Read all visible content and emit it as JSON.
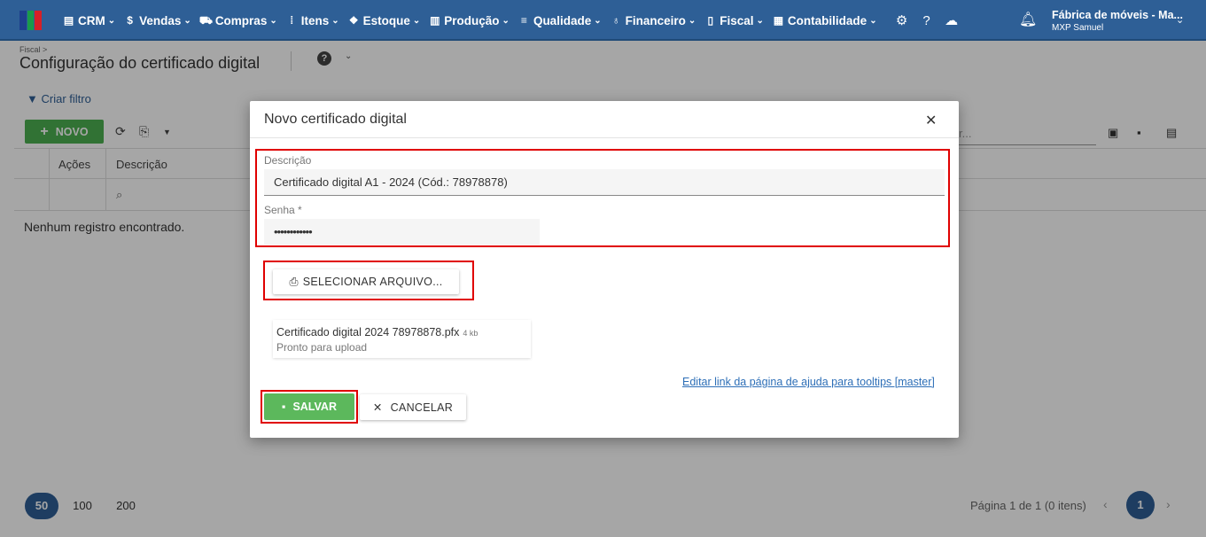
{
  "topbar": {
    "nav": [
      {
        "label": "CRM",
        "icon": "crm-icon"
      },
      {
        "label": "Vendas",
        "icon": "dollar-icon"
      },
      {
        "label": "Compras",
        "icon": "cart-icon"
      },
      {
        "label": "Itens",
        "icon": "items-icon"
      },
      {
        "label": "Estoque",
        "icon": "stock-icon"
      },
      {
        "label": "Produção",
        "icon": "factory-icon"
      },
      {
        "label": "Qualidade",
        "icon": "quality-icon"
      },
      {
        "label": "Financeiro",
        "icon": "money-bag-icon"
      },
      {
        "label": "Fiscal",
        "icon": "document-icon"
      },
      {
        "label": "Contabilidade",
        "icon": "calculator-icon"
      }
    ],
    "company_name": "Fábrica de móveis - Ma...",
    "user_name": "MXP Samuel",
    "accent": "#2e5f96"
  },
  "page": {
    "breadcrumb": "Fiscal >",
    "title": "Configuração do certificado digital",
    "create_filter": "Criar filtro",
    "new_button": "NOVO",
    "columns": [
      "Ações",
      "Descrição"
    ],
    "empty_message": "Nenhum registro encontrado.",
    "search_placeholder": "r...",
    "pager": {
      "sizes": [
        "50",
        "100",
        "200"
      ],
      "info": "Página 1 de 1 (0 itens)",
      "current_page": "1"
    }
  },
  "modal": {
    "title": "Novo certificado digital",
    "description_label": "Descrição",
    "description_value": "Certificado digital A1 - 2024 (Cód.: 78978878)",
    "password_label": "Senha *",
    "password_value": "••••••••••••",
    "select_file_button": "SELECIONAR ARQUIVO...",
    "file": {
      "name": "Certificado digital 2024 78978878.pfx",
      "size": "4 kb",
      "status": "Pronto para upload"
    },
    "help_link": "Editar link da página de ajuda para tooltips [master]",
    "save_button": "SALVAR",
    "cancel_button": "CANCELAR",
    "highlight_color": "#e00000"
  }
}
